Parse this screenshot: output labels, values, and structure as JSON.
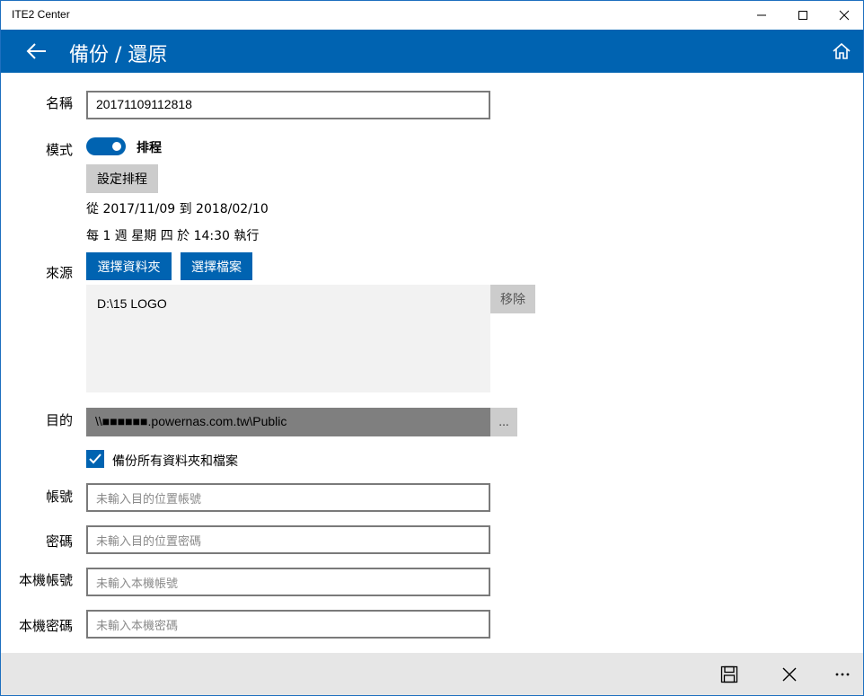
{
  "window": {
    "title": "ITE2 Center"
  },
  "header": {
    "title": "備份 / 還原"
  },
  "form": {
    "name_label": "名稱",
    "name_value": "20171109112818",
    "mode_label": "模式",
    "mode_toggle": {
      "on": true,
      "label": "排程"
    },
    "schedule_button": "設定排程",
    "date_range": "從  2017/11/09  到  2018/02/10",
    "frequency": "每 1 週 星期 四 於 14:30  執行",
    "source_label": "來源",
    "select_folder_button": "選擇資料夾",
    "select_file_button": "選擇檔案",
    "source_items": [
      "D:\\15 LOGO"
    ],
    "remove_button": "移除",
    "dest_label": "目的",
    "dest_value": "\\\\■■■■■■.powernas.com.tw\\Public",
    "browse_button": "...",
    "backup_all_checkbox": {
      "checked": true,
      "label": "備份所有資料夾和檔案"
    },
    "account_label": "帳號",
    "account_placeholder": "未輸入目的位置帳號",
    "password_label": "密碼",
    "password_placeholder": "未輸入目的位置密碼",
    "local_account_label": "本機帳號",
    "local_account_placeholder": "未輸入本機帳號",
    "local_password_label": "本機密碼",
    "local_password_placeholder": "未輸入本機密碼"
  },
  "icons": {
    "back": "back-arrow-icon",
    "home": "home-icon",
    "save": "save-icon",
    "cancel": "close-icon",
    "more": "more-icon"
  },
  "colors": {
    "accent": "#0063b1",
    "header": "#0063b1",
    "commandbar": "#e6e6e6"
  }
}
